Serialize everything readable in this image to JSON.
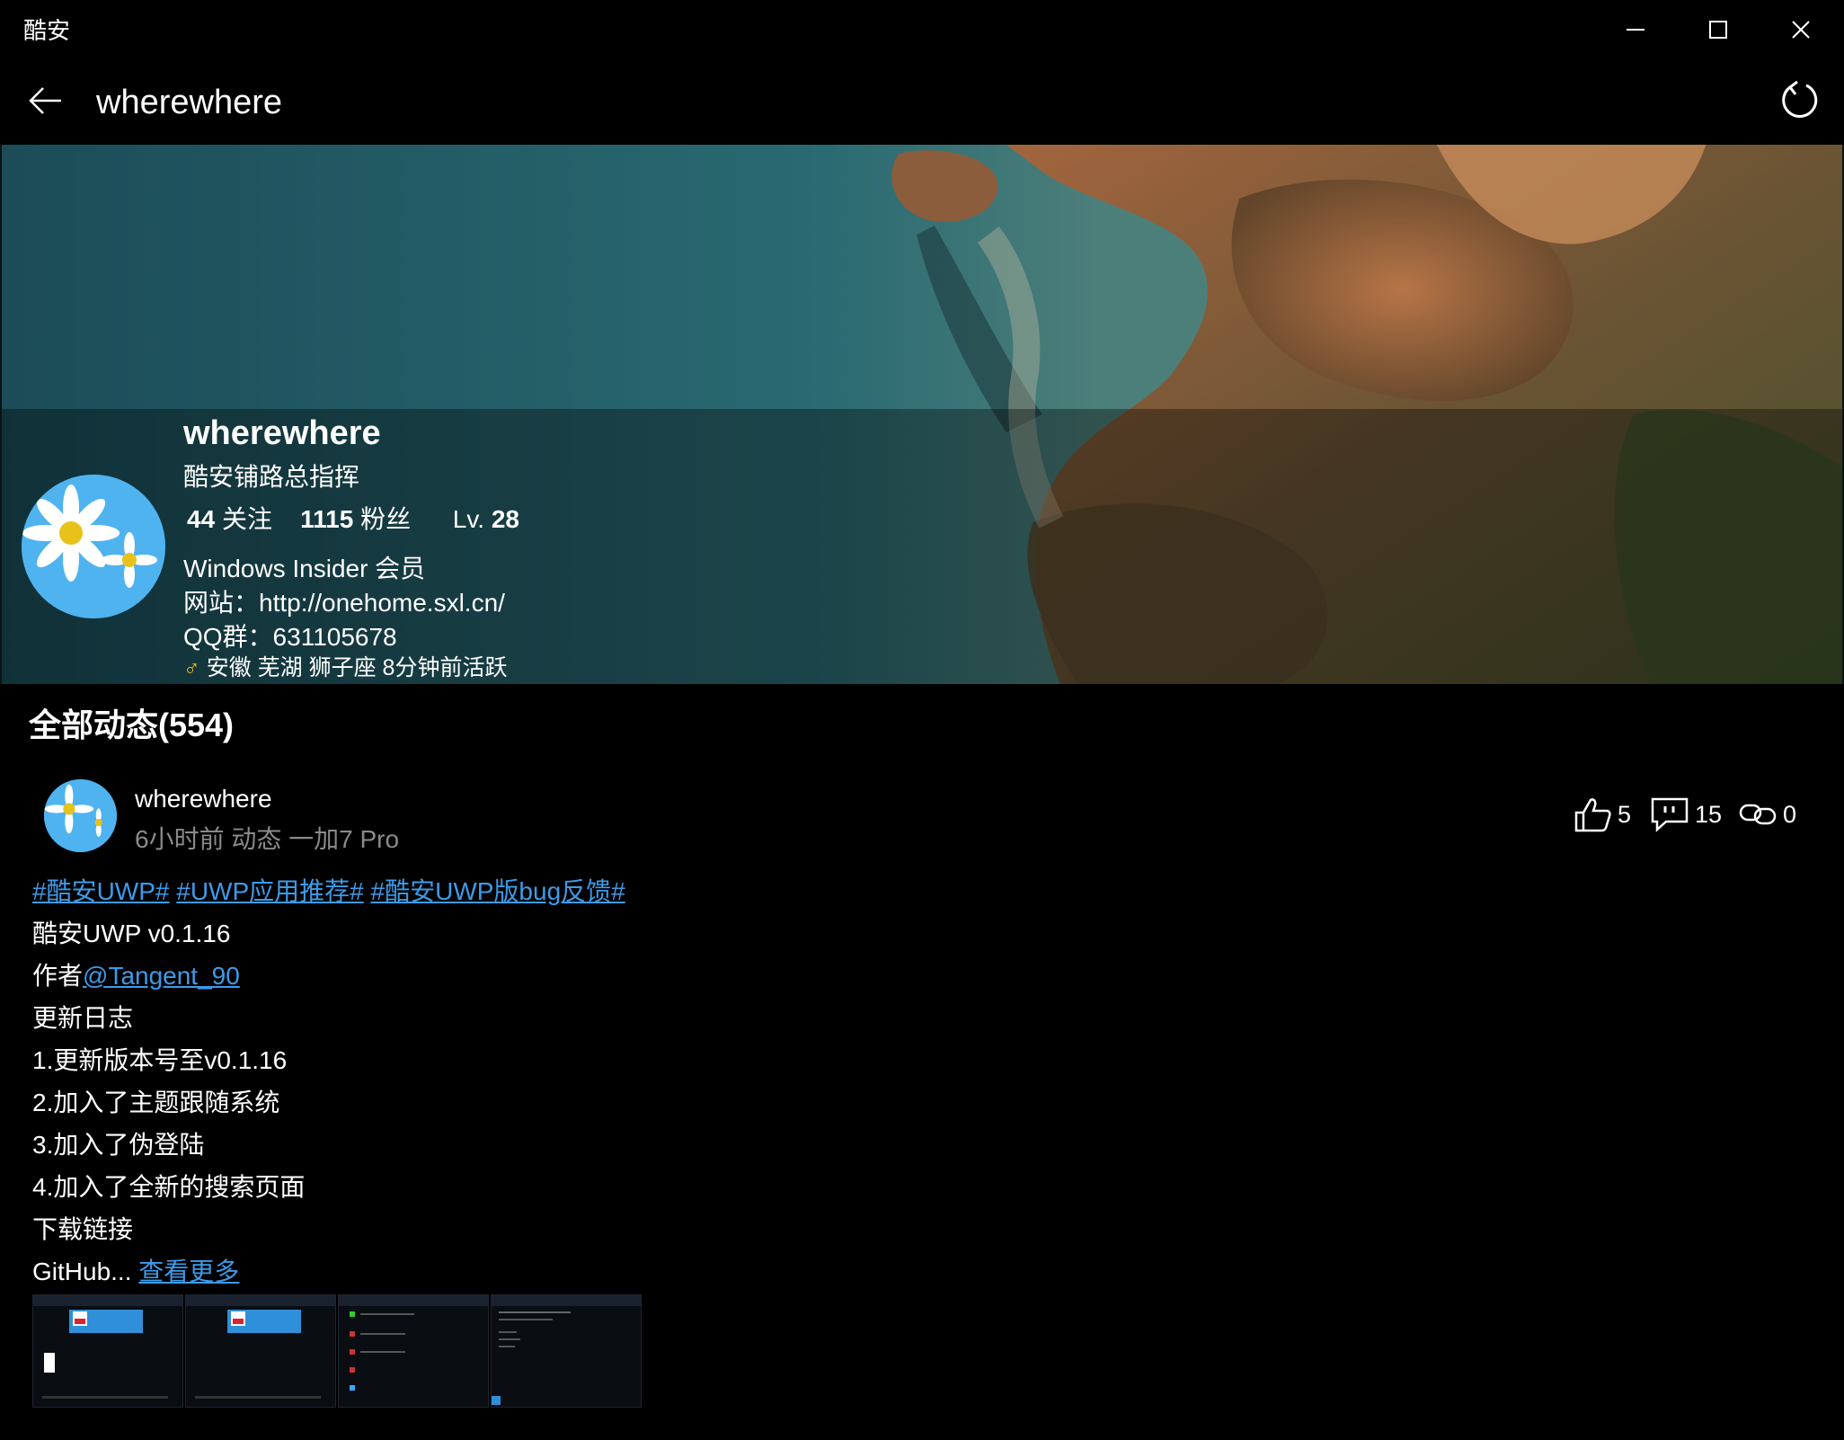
{
  "window": {
    "title": "酷安"
  },
  "nav": {
    "heading": "wherewhere"
  },
  "profile": {
    "name": "wherewhere",
    "bio": "酷安铺路总指挥",
    "following_count": "44",
    "following_label": "关注",
    "followers_count": "1115",
    "followers_label": "粉丝",
    "level_label": "Lv.",
    "level_value": "28",
    "insider": "Windows Insider 会员",
    "website": "网站：http://onehome.sxl.cn/",
    "qq": "QQ群：631105678",
    "gender_symbol": "♂",
    "location_activity": "安徽 芜湖 狮子座 8分钟前活跃"
  },
  "feed": {
    "section_title": "全部动态(554)",
    "post": {
      "author": "wherewhere",
      "meta": "6小时前  动态  一加7 Pro",
      "likes": "5",
      "comments": "15",
      "shares": "0",
      "tags": [
        "#酷安UWP#",
        "#UWP应用推荐#",
        "#酷安UWP版bug反馈#"
      ],
      "title_line": "酷安UWP v0.1.16",
      "author_prefix": "作者",
      "mention": "@Tangent_90",
      "lines": [
        "更新日志",
        "1.更新版本号至v0.1.16",
        "2.加入了主题跟随系统",
        "3.加入了伪登陆",
        "4.加入了全新的搜索页面",
        "下载链接"
      ],
      "truncated_text": "GitHub...",
      "more_link": "查看更多"
    }
  },
  "icons": {
    "back": "arrow-left-icon",
    "refresh": "refresh-icon",
    "minimize": "minimize-icon",
    "maximize": "maximize-icon",
    "close": "close-icon",
    "like": "thumbs-up-icon",
    "comment": "comment-icon",
    "share": "link-icon"
  },
  "colors": {
    "link": "#3d9be9",
    "meta": "#8a8a8a",
    "background": "#000000"
  }
}
